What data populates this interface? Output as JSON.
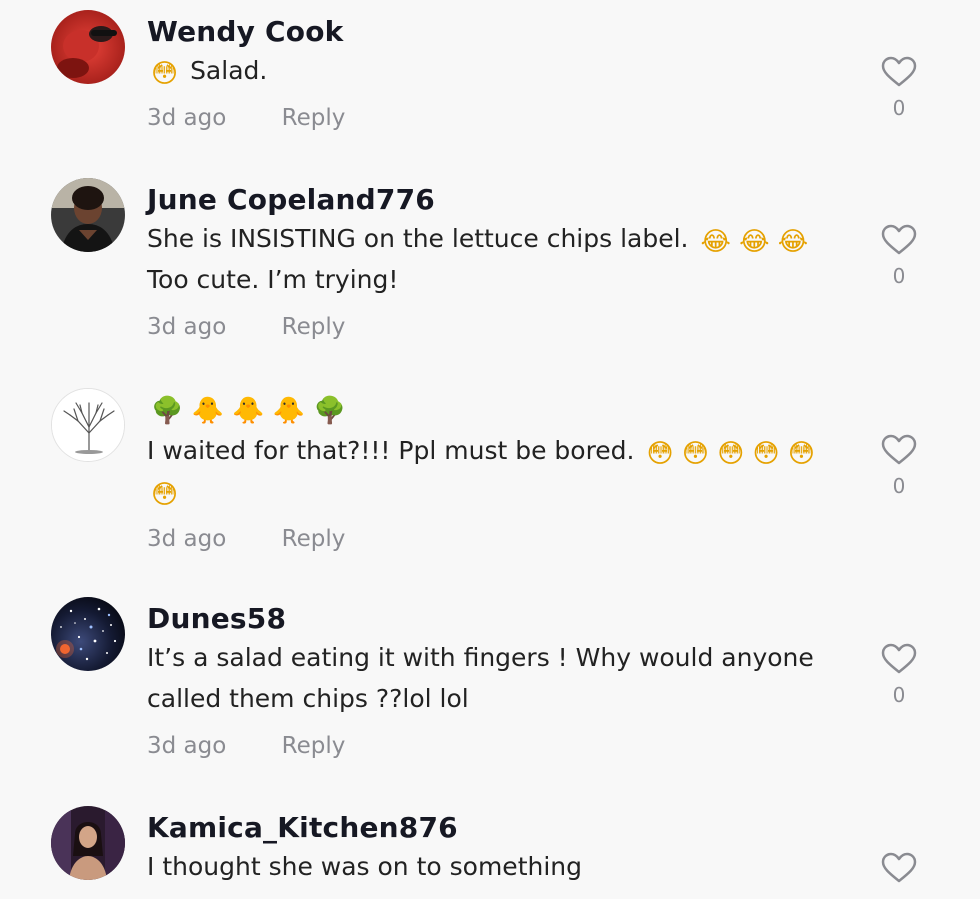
{
  "comments": [
    {
      "username": "Wendy Cook",
      "text_prefix_emoji": "😳",
      "text": "Salad.",
      "date": "3d ago",
      "reply_label": "Reply",
      "likes": "0"
    },
    {
      "username": "June Copeland776",
      "text": "She is INSISTING on the lettuce chips label.",
      "text_emoji": "😂 😂 😂",
      "text_line2": "Too cute. I’m trying!",
      "date": "3d ago",
      "reply_label": "Reply",
      "likes": "0"
    },
    {
      "username_emoji": "🌳 🐥 🐥 🐥 🌳",
      "text": "I waited for that?!!! Ppl must be bored.",
      "text_emoji": "😳 😳 😳 😳 😳",
      "text_line2_emoji": "😳",
      "date": "3d ago",
      "reply_label": "Reply",
      "likes": "0"
    },
    {
      "username": "Dunes58",
      "text": "It’s a salad eating it with fingers ! Why would anyone",
      "text_line2": "called them chips ??lol lol",
      "date": "3d ago",
      "reply_label": "Reply",
      "likes": "0"
    },
    {
      "username": "Kamica_Kitchen876",
      "text": "I thought she was on to something"
    }
  ],
  "icons": {
    "like": "heart-outline-icon"
  },
  "colors": {
    "background": "#f8f8f8",
    "username": "#161823",
    "meta": "#8a8b91"
  }
}
